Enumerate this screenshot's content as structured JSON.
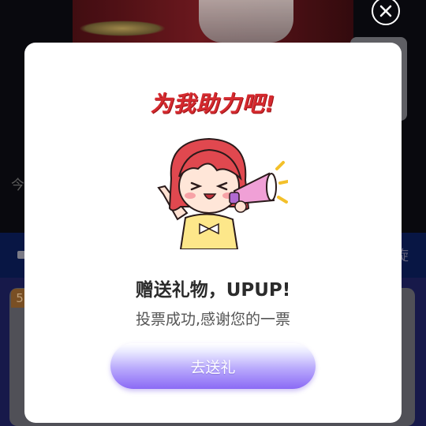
{
  "background": {
    "left_partial_text": "今",
    "right_partial_text": "旋",
    "badge_text": "5"
  },
  "modal": {
    "headline": "为我助力吧!",
    "title": "赠送礼物，UPUP!",
    "subtitle": "投票成功,感谢您的一票",
    "button_label": "去送礼"
  },
  "colors": {
    "headline": "#d52a2f",
    "button_top": "#eaeaff",
    "button_bottom": "#8b6af5",
    "nav_bar": "#0a1a4e",
    "content_bg": "#1b1d55"
  },
  "icons": {
    "close": "close-icon",
    "mascot": "cheering-girl-megaphone-illustration"
  }
}
